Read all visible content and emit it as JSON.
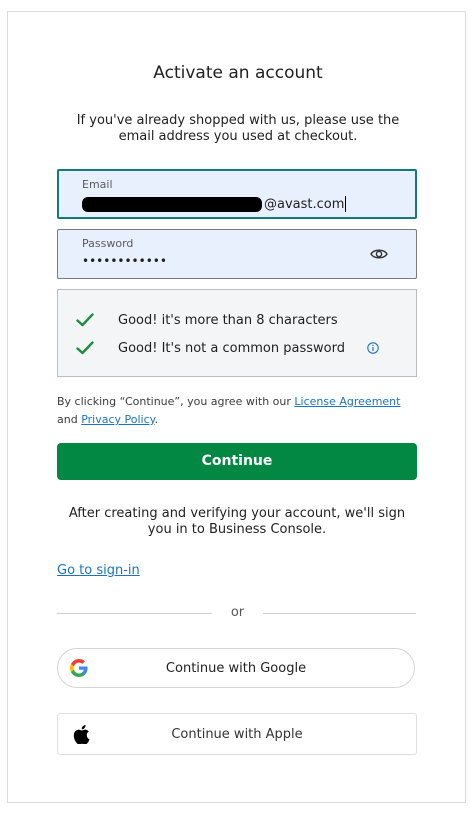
{
  "title": "Activate an account",
  "subtitle": "If you've already shopped with us, please use the email address you used at checkout.",
  "email": {
    "label": "Email",
    "value_visible": "@avast.com"
  },
  "password": {
    "label": "Password",
    "masked_value": "••••••••••••",
    "toggle_icon": "eye-icon"
  },
  "password_checks": [
    {
      "text": "Good! it's more than 8 characters",
      "icon": "check-icon",
      "color": "#1e8e3e"
    },
    {
      "text": "Good! It's not a common password",
      "icon": "check-icon",
      "color": "#1e8e3e",
      "info_icon": "info-icon"
    }
  ],
  "legal": {
    "prefix": "By clicking “Continue”, you agree with our ",
    "license_link": "License Agreement",
    "middle": " and ",
    "privacy_link": "Privacy Policy",
    "suffix": "."
  },
  "continue_button": {
    "label": "Continue",
    "color": "#028842"
  },
  "after_text": "After creating and verifying your account, we'll sign you in to Business Console.",
  "go_to_signin": "Go to sign-in",
  "divider_text": "or",
  "google_button": {
    "label": "Continue with Google",
    "icon": "google-icon"
  },
  "apple_button": {
    "label": "Continue with Apple",
    "icon": "apple-icon"
  }
}
